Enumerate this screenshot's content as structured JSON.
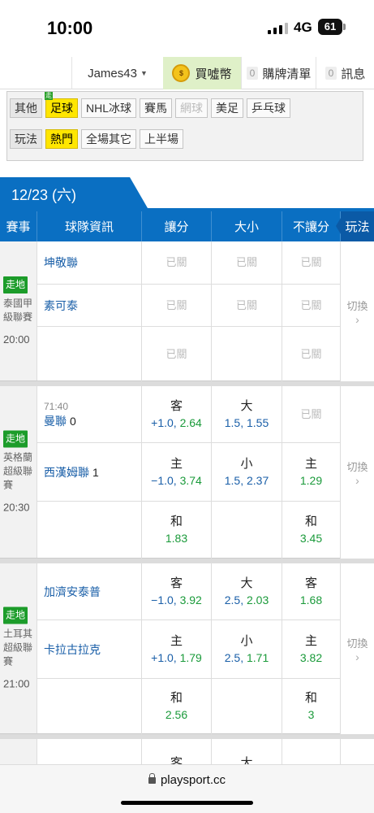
{
  "status": {
    "time": "10:00",
    "network": "4G",
    "battery": "61"
  },
  "nav": {
    "user": "James43",
    "coins": "買噓幣",
    "cart_count": "0",
    "cart": "購牌清單",
    "msg_count": "0",
    "msg": "訊息"
  },
  "filters": {
    "sport_label": "其他",
    "sports": [
      "足球",
      "NHL冰球",
      "賽馬",
      "網球",
      "美足",
      "乒乓球"
    ],
    "sport_live_badge": "走",
    "play_label": "玩法",
    "plays": [
      "熱門",
      "全場其它",
      "上半場"
    ]
  },
  "date": "12/23 (六)",
  "headers": [
    "賽事",
    "球隊資訊",
    "讓分",
    "大小",
    "不讓分",
    "玩法"
  ],
  "live_label": "走地",
  "switch_label": "切換",
  "switch_arrow": "›",
  "closed": "已關",
  "matches": [
    {
      "league": "泰國甲級聯賽",
      "time": "20:00",
      "away": {
        "name": "坤敬聯"
      },
      "home": {
        "name": "素可泰"
      }
    },
    {
      "league": "英格蘭超級聯賽",
      "time": "20:30",
      "clock": "71:40",
      "away": {
        "name": "曼聯",
        "score": "0"
      },
      "home": {
        "name": "西漢姆聯",
        "score": "1"
      },
      "spread": {
        "away_type": "客",
        "away_line": "+1.0,",
        "away_odds": "2.64",
        "home_type": "主",
        "home_line": "−1.0,",
        "home_odds": "3.74"
      },
      "total": {
        "over_type": "大",
        "over_line": "1.5,",
        "over_odds": "1.55",
        "under_type": "小",
        "under_line": "1.5,",
        "under_odds": "2.37"
      },
      "ml": {
        "home_type": "主",
        "home_odds": "1.29"
      },
      "draw": {
        "type": "和",
        "spread_odds": "1.83",
        "ml_odds": "3.45"
      }
    },
    {
      "league": "土耳其超級聯賽",
      "time": "21:00",
      "away": {
        "name": "加濟安泰普"
      },
      "home": {
        "name": "卡拉古拉克"
      },
      "spread": {
        "away_type": "客",
        "away_line": "−1.0,",
        "away_odds": "3.92",
        "home_type": "主",
        "home_line": "+1.0,",
        "home_odds": "1.79"
      },
      "total": {
        "over_type": "大",
        "over_line": "2.5,",
        "over_odds": "2.03",
        "under_type": "小",
        "under_line": "2.5,",
        "under_odds": "1.71"
      },
      "ml": {
        "away_type": "客",
        "away_odds": "1.68",
        "home_type": "主",
        "home_odds": "3.82"
      },
      "draw": {
        "type": "和",
        "spread_odds": "2.56",
        "ml_odds": "3"
      }
    },
    {
      "partial": {
        "spread_type": "客",
        "total_type": "大"
      }
    }
  ],
  "url": "playsport.cc"
}
